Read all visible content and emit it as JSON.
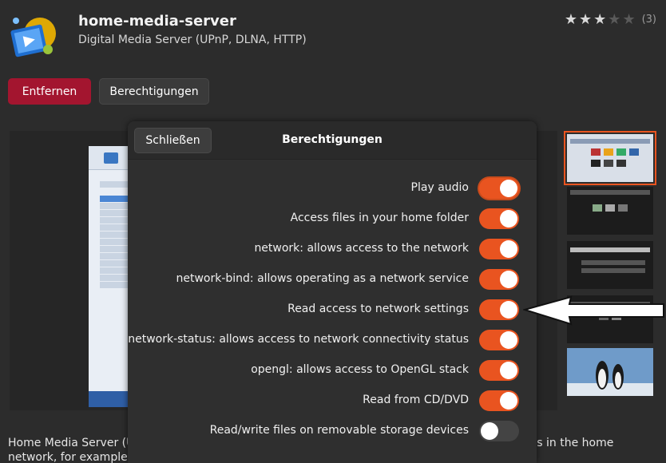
{
  "app": {
    "name": "home-media-server",
    "summary": "Digital Media Server (UPnP, DLNA, HTTP)",
    "icon": "media-server-app-icon",
    "rating_stars": 3,
    "rating_max": 5,
    "rating_count": "(3)"
  },
  "actions": {
    "remove_label": "Entfernen",
    "permissions_label": "Berechtigungen"
  },
  "description": "Home Media Server (U… audio and video files) on your computer to other UPnP (DLNA) devices in the home network, for example, Philips TVs (SimplyShare), Sony TVs,",
  "dialog": {
    "close_label": "Schließen",
    "title": "Berechtigungen",
    "permissions": [
      {
        "label": "Play audio",
        "enabled": true
      },
      {
        "label": "Access files in your home folder",
        "enabled": true
      },
      {
        "label": "network: allows access to the network",
        "enabled": true
      },
      {
        "label": "network-bind: allows operating as a network service",
        "enabled": true
      },
      {
        "label": "Read access to network settings",
        "enabled": true
      },
      {
        "label": "network-status: allows access to network connectivity status",
        "enabled": true
      },
      {
        "label": "opengl: allows access to OpenGL stack",
        "enabled": true
      },
      {
        "label": "Read from CD/DVD",
        "enabled": true
      },
      {
        "label": "Read/write files on removable storage devices",
        "enabled": false
      }
    ]
  },
  "colors": {
    "accent": "#e95420",
    "remove_button": "#a3152f",
    "background": "#2c2c2c"
  }
}
